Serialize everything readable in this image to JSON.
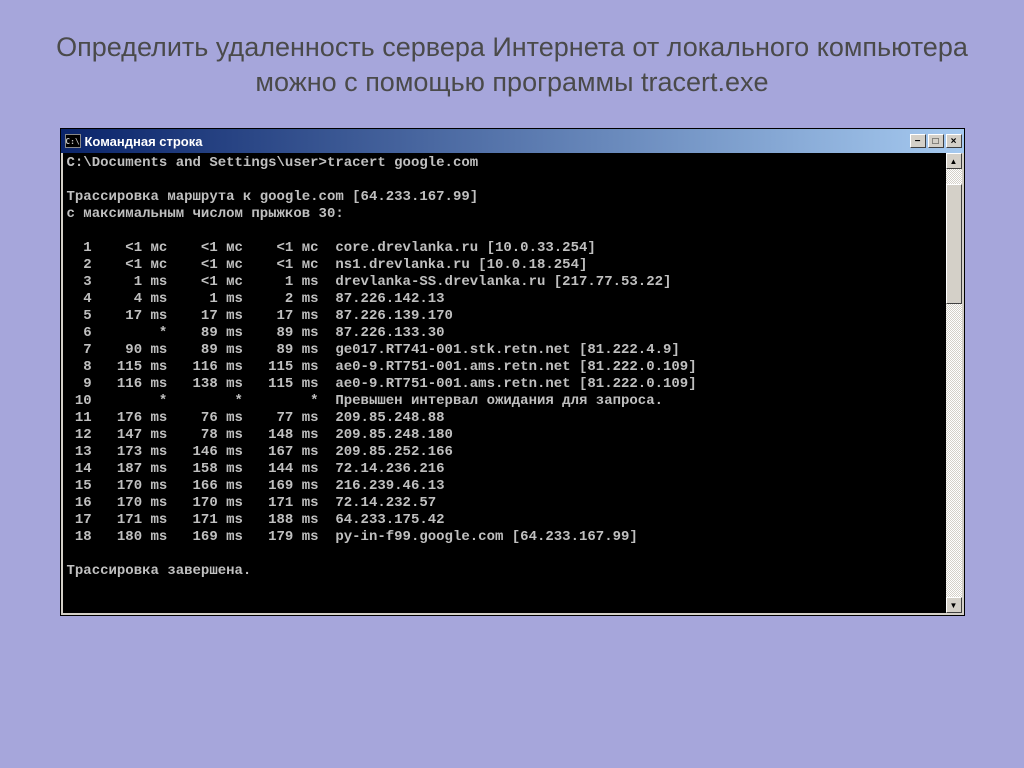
{
  "slide": {
    "title": "Определить удаленность сервера Интернета от локального компьютера можно с помощью программы tracert.exe"
  },
  "window": {
    "title": "Командная строка",
    "icon_label": "C:\\",
    "buttons": {
      "minimize": "−",
      "maximize": "□",
      "close": "×"
    },
    "scroll": {
      "up": "▲",
      "down": "▼"
    }
  },
  "console": {
    "prompt_line": "C:\\Documents and Settings\\user>tracert google.com",
    "trace_header": "Трассировка маршрута к google.com [64.233.167.99]",
    "trace_header2": "с максимальным числом прыжков 30:",
    "footer": "Трассировка завершена.",
    "hops": [
      {
        "n": "1",
        "t1": "<1 мс",
        "t2": "<1 мс",
        "t3": "<1 мс",
        "host": "core.drevlanka.ru [10.0.33.254]"
      },
      {
        "n": "2",
        "t1": "<1 мс",
        "t2": "<1 мс",
        "t3": "<1 мс",
        "host": "ns1.drevlanka.ru [10.0.18.254]"
      },
      {
        "n": "3",
        "t1": "1 ms",
        "t2": "<1 мс",
        "t3": "1 ms",
        "host": "drevlanka-SS.drevlanka.ru [217.77.53.22]"
      },
      {
        "n": "4",
        "t1": "4 ms",
        "t2": "1 ms",
        "t3": "2 ms",
        "host": "87.226.142.13"
      },
      {
        "n": "5",
        "t1": "17 ms",
        "t2": "17 ms",
        "t3": "17 ms",
        "host": "87.226.139.170"
      },
      {
        "n": "6",
        "t1": "*",
        "t2": "89 ms",
        "t3": "89 ms",
        "host": "87.226.133.30"
      },
      {
        "n": "7",
        "t1": "90 ms",
        "t2": "89 ms",
        "t3": "89 ms",
        "host": "ge017.RT741-001.stk.retn.net [81.222.4.9]"
      },
      {
        "n": "8",
        "t1": "115 ms",
        "t2": "116 ms",
        "t3": "115 ms",
        "host": "ae0-9.RT751-001.ams.retn.net [81.222.0.109]"
      },
      {
        "n": "9",
        "t1": "116 ms",
        "t2": "138 ms",
        "t3": "115 ms",
        "host": "ae0-9.RT751-001.ams.retn.net [81.222.0.109]"
      },
      {
        "n": "10",
        "t1": "*",
        "t2": "*",
        "t3": "*",
        "host": "Превышен интервал ожидания для запроса."
      },
      {
        "n": "11",
        "t1": "176 ms",
        "t2": "76 ms",
        "t3": "77 ms",
        "host": "209.85.248.88"
      },
      {
        "n": "12",
        "t1": "147 ms",
        "t2": "78 ms",
        "t3": "148 ms",
        "host": "209.85.248.180"
      },
      {
        "n": "13",
        "t1": "173 ms",
        "t2": "146 ms",
        "t3": "167 ms",
        "host": "209.85.252.166"
      },
      {
        "n": "14",
        "t1": "187 ms",
        "t2": "158 ms",
        "t3": "144 ms",
        "host": "72.14.236.216"
      },
      {
        "n": "15",
        "t1": "170 ms",
        "t2": "166 ms",
        "t3": "169 ms",
        "host": "216.239.46.13"
      },
      {
        "n": "16",
        "t1": "170 ms",
        "t2": "170 ms",
        "t3": "171 ms",
        "host": "72.14.232.57"
      },
      {
        "n": "17",
        "t1": "171 ms",
        "t2": "171 ms",
        "t3": "188 ms",
        "host": "64.233.175.42"
      },
      {
        "n": "18",
        "t1": "180 ms",
        "t2": "169 ms",
        "t3": "179 ms",
        "host": "py-in-f99.google.com [64.233.167.99]"
      }
    ]
  }
}
